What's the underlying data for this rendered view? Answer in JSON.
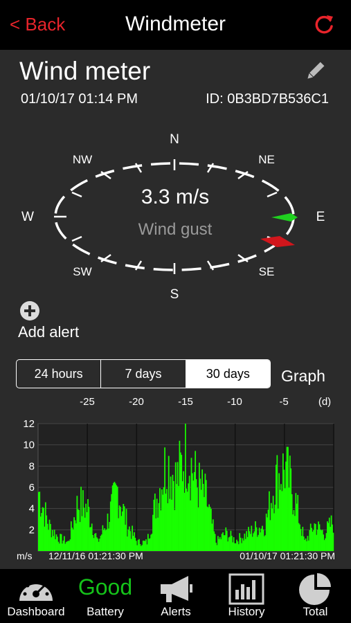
{
  "nav": {
    "back_label": "< Back",
    "title": "Windmeter"
  },
  "device": {
    "name": "Wind meter",
    "date": "01/10/17   01:14 PM",
    "id_label": "ID: 0B3BD7B536C1"
  },
  "compass": {
    "labels": {
      "n": "N",
      "ne": "NE",
      "e": "E",
      "se": "SE",
      "s": "S",
      "sw": "SW",
      "w": "W",
      "nw": "NW"
    },
    "speed": "3.3 m/s",
    "speed_caption": "Wind gust",
    "green_needle_dir": "E",
    "red_needle_dir": "ESE"
  },
  "alert": {
    "label": "Add alert"
  },
  "ranges": {
    "options": [
      "24 hours",
      "7 days",
      "30 days"
    ],
    "selected": "30 days",
    "graph_label": "Graph"
  },
  "chart_data": {
    "type": "area",
    "top_ticks": [
      "-25",
      "-20",
      "-15",
      "-10",
      "-5",
      "(d)"
    ],
    "y_ticks": [
      "12",
      "10",
      "8",
      "6",
      "4",
      "2"
    ],
    "ylim": [
      0,
      12
    ],
    "y_unit": "m/s",
    "start_label": "12/11/16   01:21:30 PM",
    "end_label": "01/10/17   01:21:30 PM",
    "series_color": "#19ff00",
    "x_days": [
      -30,
      -29,
      -28,
      -27,
      -26,
      -25,
      -24,
      -23,
      -22,
      -21,
      -20,
      -19,
      -18,
      -17,
      -16,
      -15,
      -14,
      -13,
      -12,
      -11,
      -10,
      -9,
      -8,
      -7,
      -6,
      -5,
      -4,
      -3,
      -2,
      -1,
      0
    ],
    "values": [
      6.8,
      3.0,
      1.5,
      1.0,
      5.5,
      4.8,
      1.0,
      3.5,
      7.0,
      3.0,
      1.0,
      1.0,
      6.0,
      10.2,
      8.0,
      11.5,
      8.0,
      6.0,
      1.0,
      2.0,
      1.2,
      1.8,
      2.5,
      3.0,
      8.0,
      9.5,
      6.0,
      1.0,
      3.0,
      2.0,
      3.5
    ]
  },
  "tabs": {
    "dashboard": "Dashboard",
    "battery": "Battery",
    "battery_status": "Good",
    "alerts": "Alerts",
    "history": "History",
    "total": "Total"
  },
  "colors": {
    "accent_red": "#e8242b",
    "good_green": "#15c21a"
  }
}
